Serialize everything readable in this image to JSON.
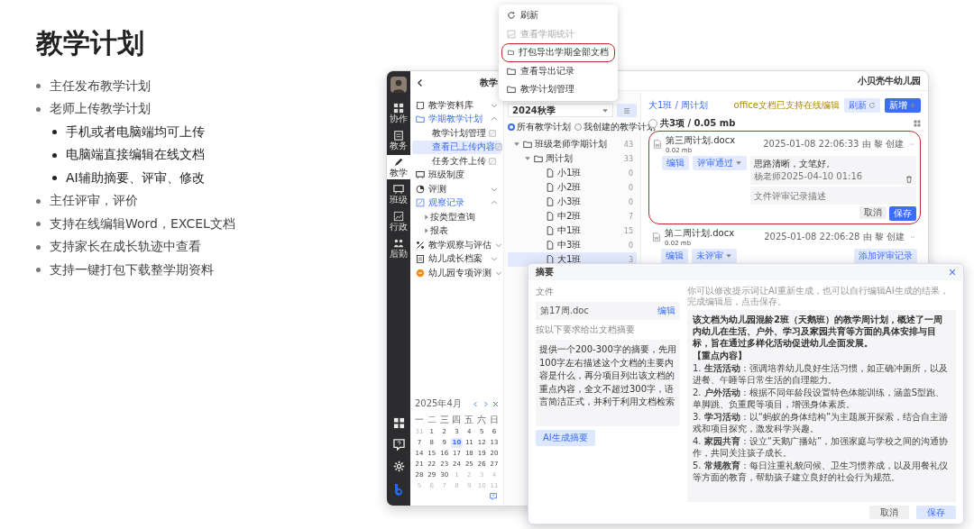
{
  "slide": {
    "title": "教学计划",
    "bullets": [
      {
        "text": "主任发布教学计划"
      },
      {
        "text": "老师上传教学计划",
        "children": [
          {
            "text": "手机或者电脑端均可上传"
          },
          {
            "text": "电脑端直接编辑在线文档"
          },
          {
            "text": "AI辅助摘要、评审、修改"
          }
        ]
      },
      {
        "text": "主任评审，评价"
      },
      {
        "text": "支持在线编辑Word，EXCEL文档"
      },
      {
        "text": "支持家长在成长轨迹中查看"
      },
      {
        "text": "支持一键打包下载整学期资料"
      }
    ]
  },
  "app": {
    "rail": {
      "items": [
        {
          "label": "协作",
          "selected": false
        },
        {
          "label": "教务",
          "selected": false
        },
        {
          "label": "教学",
          "selected": true
        },
        {
          "label": "班级",
          "selected": false
        },
        {
          "label": "行政",
          "selected": false
        },
        {
          "label": "后勤",
          "selected": false
        }
      ]
    },
    "nav": {
      "title": "教学",
      "items": [
        {
          "label": "教学资料库",
          "expanded": false,
          "selected": false
        },
        {
          "label": "学期教学计划",
          "expanded": true,
          "selected": false,
          "children": [
            {
              "label": "教学计划管理",
              "selected": false
            },
            {
              "label": "查看已上传内容",
              "selected": true
            },
            {
              "label": "任务文件上传",
              "selected": false
            }
          ]
        },
        {
          "label": "班级制度",
          "selected": false
        },
        {
          "label": "评测",
          "expanded": false,
          "selected": false
        },
        {
          "label": "观察记录",
          "expanded": true,
          "selected": false,
          "children": [
            {
              "label": "按类型查询",
              "selected": false
            },
            {
              "label": "报表",
              "selected": false
            }
          ]
        },
        {
          "label": "教学观察与评估",
          "expanded": false,
          "selected": false
        },
        {
          "label": "幼儿成长档案",
          "expanded": false,
          "selected": false
        },
        {
          "label": "幼儿园专项评测",
          "expanded": false,
          "selected": false
        }
      ]
    },
    "calendar": {
      "month": "2025年4月",
      "weekdays": [
        "一",
        "二",
        "三",
        "四",
        "五",
        "六",
        "日"
      ],
      "weeks": [
        [
          {
            "day": "31",
            "outside": true,
            "selected": false
          },
          {
            "day": "1",
            "outside": false,
            "selected": false
          },
          {
            "day": "2",
            "outside": false,
            "selected": false
          },
          {
            "day": "3",
            "outside": false,
            "selected": false
          },
          {
            "day": "4",
            "outside": false,
            "selected": false
          },
          {
            "day": "5",
            "outside": false,
            "selected": false
          },
          {
            "day": "6",
            "outside": false,
            "selected": false
          }
        ],
        [
          {
            "day": "7",
            "outside": false,
            "selected": false
          },
          {
            "day": "8",
            "outside": false,
            "selected": false
          },
          {
            "day": "9",
            "outside": false,
            "selected": false
          },
          {
            "day": "10",
            "outside": false,
            "selected": true
          },
          {
            "day": "11",
            "outside": false,
            "selected": false
          },
          {
            "day": "12",
            "outside": false,
            "selected": false
          },
          {
            "day": "13",
            "outside": false,
            "selected": false
          }
        ],
        [
          {
            "day": "14",
            "outside": false,
            "selected": false
          },
          {
            "day": "15",
            "outside": false,
            "selected": false
          },
          {
            "day": "16",
            "outside": false,
            "selected": false
          },
          {
            "day": "17",
            "outside": false,
            "selected": false
          },
          {
            "day": "18",
            "outside": false,
            "selected": false
          },
          {
            "day": "19",
            "outside": false,
            "selected": false
          },
          {
            "day": "20",
            "outside": false,
            "selected": false
          }
        ],
        [
          {
            "day": "21",
            "outside": false,
            "selected": false
          },
          {
            "day": "22",
            "outside": false,
            "selected": false
          },
          {
            "day": "23",
            "outside": false,
            "selected": false
          },
          {
            "day": "24",
            "outside": false,
            "selected": false
          },
          {
            "day": "25",
            "outside": false,
            "selected": false
          },
          {
            "day": "26",
            "outside": false,
            "selected": false
          },
          {
            "day": "27",
            "outside": false,
            "selected": false
          }
        ],
        [
          {
            "day": "28",
            "outside": false,
            "selected": false
          },
          {
            "day": "29",
            "outside": false,
            "selected": false
          },
          {
            "day": "30",
            "outside": false,
            "selected": false
          },
          {
            "day": "1",
            "outside": true,
            "selected": false
          },
          {
            "day": "2",
            "outside": true,
            "selected": false
          },
          {
            "day": "3",
            "outside": true,
            "selected": false
          },
          {
            "day": "4",
            "outside": true,
            "selected": false
          }
        ],
        [
          {
            "day": "5",
            "outside": true,
            "selected": false
          },
          {
            "day": "6",
            "outside": true,
            "selected": false
          },
          {
            "day": "7",
            "outside": true,
            "selected": false
          },
          {
            "day": "8",
            "outside": true,
            "selected": false
          },
          {
            "day": "9",
            "outside": true,
            "selected": false
          },
          {
            "day": "10",
            "outside": true,
            "selected": false
          },
          {
            "day": "11",
            "outside": true,
            "selected": false
          }
        ]
      ]
    },
    "header": {
      "school": "小贝壳牛幼儿园"
    },
    "tree": {
      "term": "2024秋季",
      "filters": [
        {
          "label": "所有教学计划",
          "selected": true
        },
        {
          "label": "我创建的教学计划",
          "selected": false
        }
      ],
      "nodes": [
        {
          "label": "班级老师学期计划",
          "count": "43",
          "expanded": true,
          "selected": false,
          "children": [
            {
              "label": "周计划",
              "count": "33",
              "expanded": true,
              "selected": false,
              "children": [
                {
                  "label": "小1班",
                  "count": "0",
                  "selected": false
                },
                {
                  "label": "小2班",
                  "count": "0",
                  "selected": false
                },
                {
                  "label": "小3班",
                  "count": "0",
                  "selected": false
                },
                {
                  "label": "中2班",
                  "count": "7",
                  "selected": false
                },
                {
                  "label": "中1班",
                  "count": "15",
                  "selected": false
                },
                {
                  "label": "中3班",
                  "count": "0",
                  "selected": false
                },
                {
                  "label": "大1班",
                  "count": "3",
                  "selected": true
                }
              ]
            }
          ]
        }
      ]
    },
    "content": {
      "breadcrumb": "大1班 / 周计划",
      "notice": "office文档已支持在线编辑",
      "refresh": "刷新",
      "add": "新增",
      "total": "共3项 / 0.05 mb",
      "all_selected": false,
      "documents": [
        {
          "name": "第三周计划.docx",
          "size": "0.02 mb",
          "created": "2025-01-08 22:06:33 由 黎 创建",
          "edit": "编辑",
          "review": "评审通过",
          "annotated": true,
          "comments": [
            {
              "text": "思路清晰，文笔好。",
              "author": "杨老师2025-04-10 01:16"
            }
          ],
          "comment_placeholder": "文件评审记录描述",
          "actions": [
            {
              "label": "取消",
              "primary": false
            },
            {
              "label": "保存",
              "primary": true
            }
          ]
        },
        {
          "name": "第二周计划.docx",
          "size": "0.02 mb",
          "created": "2025-01-08 22:06:28 由 黎 创建",
          "edit": "编辑",
          "review": "未评审",
          "annotated": false,
          "add_review": "添加评审记录"
        }
      ]
    }
  },
  "menu": {
    "items": [
      {
        "label": "刷新",
        "disabled": false,
        "annotated": false
      },
      {
        "label": "查看学期统计",
        "disabled": true,
        "annotated": false
      },
      {
        "label": "打包导出学期全部文档",
        "disabled": false,
        "annotated": true
      },
      {
        "label": "查看导出记录",
        "disabled": false,
        "annotated": false
      },
      {
        "label": "教学计划管理",
        "disabled": false,
        "annotated": false
      }
    ]
  },
  "dialog": {
    "title": "摘要",
    "file_label": "文件",
    "file": "第17周.doc",
    "file_action": "编辑",
    "prompt_label": "按以下要求给出文档摘要",
    "prompt": "提供一个200-300字的摘要，先用100字左右描述这个文档的主要内容是什么，再分项目列出该文档的重点内容，全文不超过300字，语言简洁正式，并利于利用文档检索",
    "generate": "AI生成摘要",
    "hint": "你可以修改提示词让AI重新生成，也可以自行编辑AI生成的结果，完成编辑后，点击保存。",
    "summary": {
      "intro": "该文档为幼儿园混龄2班（天鹅班）的教学周计划，概述了一周内幼儿在生活、户外、学习及家园共育等方面的具体安排与目标，旨在通过多样化活动促进幼儿全面发展。",
      "heading": "【重点内容】",
      "points": [
        "1. **生活活动**：强调培养幼儿良好生活习惯，如正确冲厕所，以及进餐、午睡等日常生活的自理能力。",
        "2. **户外活动**：根据不同年龄段设置特色体能训练，涵盖S型跑、单脚跳、负重爬等项目，增强身体素质。",
        "3. **学习活动**：以“蚂蚁的身体结构”为主题展开探索，结合自主游戏和项目探究，激发科学兴趣。",
        "4. **家园共育**：设立“天鹅广播站”，加强家庭与学校之间的沟通协作，共同关注孩子成长。",
        "5. **常规教育**：每日注重礼貌问候、卫生习惯养成，以及用餐礼仪等方面的教育，帮助孩子建立良好的社会行为规范。"
      ]
    },
    "buttons": [
      {
        "label": "取消",
        "primary": false
      },
      {
        "label": "保存",
        "primary": true
      }
    ]
  }
}
